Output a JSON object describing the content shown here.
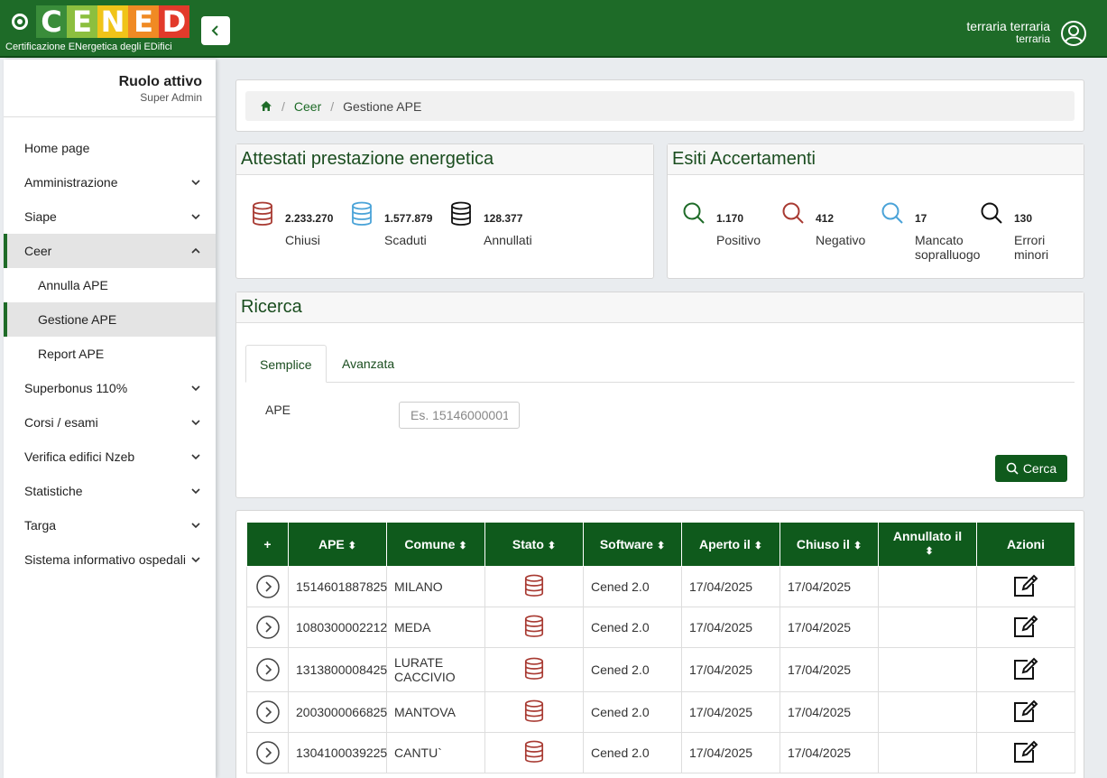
{
  "header": {
    "logo_letters": [
      "C",
      "E",
      "N",
      "E",
      "D"
    ],
    "logo_letter_colors": [
      "#3a8d3a",
      "#8cbf3f",
      "#f0c419",
      "#f08a24",
      "#e23a2b"
    ],
    "logo_tagline": "Certificazione ENergetica degli EDifici",
    "user_name": "terraria terraria",
    "user_sub": "terraria",
    "primary_color": "#1e6b28"
  },
  "sidebar": {
    "role_title": "Ruolo attivo",
    "role_sub": "Super Admin",
    "items": [
      {
        "label": "Home page",
        "chevron": "none"
      },
      {
        "label": "Amministrazione",
        "chevron": "down"
      },
      {
        "label": "Siape",
        "chevron": "down"
      },
      {
        "label": "Ceer",
        "chevron": "up"
      },
      {
        "label": "Annulla APE",
        "chevron": "none"
      },
      {
        "label": "Gestione APE",
        "chevron": "none"
      },
      {
        "label": "Report APE",
        "chevron": "none"
      },
      {
        "label": "Superbonus 110%",
        "chevron": "down"
      },
      {
        "label": "Corsi / esami",
        "chevron": "down"
      },
      {
        "label": "Verifica edifici Nzeb",
        "chevron": "down"
      },
      {
        "label": "Statistiche",
        "chevron": "down"
      },
      {
        "label": "Targa",
        "chevron": "down"
      },
      {
        "label": "Sistema informativo ospedali",
        "chevron": "down"
      }
    ]
  },
  "breadcrumb": {
    "home_icon": "home-icon",
    "level1": "Ceer",
    "level2": "Gestione APE"
  },
  "attestati": {
    "title": "Attestati prestazione energetica",
    "stats": [
      {
        "value": "2.233.270",
        "label": "Chiusi",
        "color": "#a83a32"
      },
      {
        "value": "1.577.879",
        "label": "Scaduti",
        "color": "#4aa3d8"
      },
      {
        "value": "128.377",
        "label": "Annullati",
        "color": "#111111"
      }
    ]
  },
  "esiti": {
    "title": "Esiti Accertamenti",
    "stats": [
      {
        "value": "1.170",
        "label": "Positivo",
        "color": "#1e6b28"
      },
      {
        "value": "412",
        "label": "Negativo",
        "color": "#a83a32"
      },
      {
        "value": "17",
        "label": "Mancato sopralluogo",
        "color": "#4aa3d8"
      },
      {
        "value": "130",
        "label": "Errori minori",
        "color": "#111111"
      }
    ]
  },
  "ricerca": {
    "title": "Ricerca",
    "tab_semplice": "Semplice",
    "tab_avanzata": "Avanzata",
    "ape_label": "APE",
    "ape_placeholder": "Es. 15146000001",
    "search_button": "Cerca"
  },
  "table": {
    "headers": [
      "+",
      "APE",
      "Comune",
      "Stato",
      "Software",
      "Aperto il",
      "Chiuso il",
      "Annullato il",
      "Azioni"
    ],
    "rows": [
      {
        "ape": "1514601887825",
        "comune": "MILANO",
        "stato": "database-icon",
        "software": "Cened 2.0",
        "aperto": "17/04/2025",
        "chiuso": "17/04/2025",
        "annullato": ""
      },
      {
        "ape": "1080300002212",
        "comune": "MEDA",
        "stato": "database-icon",
        "software": "Cened 2.0",
        "aperto": "17/04/2025",
        "chiuso": "17/04/2025",
        "annullato": ""
      },
      {
        "ape": "1313800008425",
        "comune": "LURATE CACCIVIO",
        "stato": "database-icon",
        "software": "Cened 2.0",
        "aperto": "17/04/2025",
        "chiuso": "17/04/2025",
        "annullato": ""
      },
      {
        "ape": "2003000066825",
        "comune": "MANTOVA",
        "stato": "database-icon",
        "software": "Cened 2.0",
        "aperto": "17/04/2025",
        "chiuso": "17/04/2025",
        "annullato": ""
      },
      {
        "ape": "1304100039225",
        "comune": "CANTU`",
        "stato": "database-icon",
        "software": "Cened 2.0",
        "aperto": "17/04/2025",
        "chiuso": "17/04/2025",
        "annullato": ""
      }
    ]
  }
}
